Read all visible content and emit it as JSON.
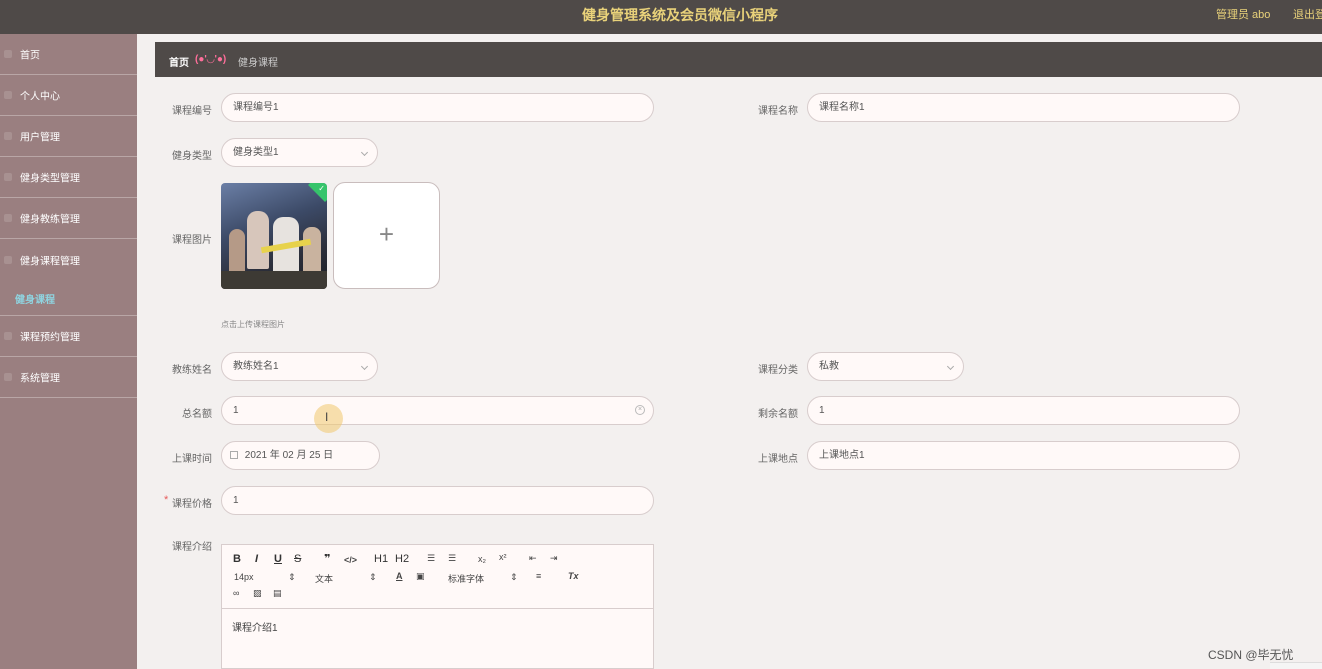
{
  "app": {
    "title": "健身管理系统及会员微信小程序",
    "user": "管理员 abo",
    "logout": "退出登"
  },
  "sidebar": {
    "items": [
      {
        "label": "首页",
        "icon": "home-icon"
      },
      {
        "label": "个人中心",
        "icon": "user-icon"
      },
      {
        "label": "用户管理",
        "icon": "users-icon"
      },
      {
        "label": "健身类型管理",
        "icon": "list-icon"
      },
      {
        "label": "健身教练管理",
        "icon": "coach-icon"
      },
      {
        "label": "健身课程管理",
        "icon": "course-icon"
      },
      {
        "label": "课程预约管理",
        "icon": "booking-icon"
      },
      {
        "label": "系统管理",
        "icon": "settings-icon"
      }
    ],
    "active_sub": "健身课程"
  },
  "breadcrumb": {
    "home": "首页",
    "face": "(●'◡'●)",
    "current": "健身课程"
  },
  "form": {
    "course_no": {
      "label": "课程编号",
      "value": "课程编号1"
    },
    "course_name": {
      "label": "课程名称",
      "value": "课程名称1"
    },
    "fitness_type": {
      "label": "健身类型",
      "value": "健身类型1"
    },
    "course_image": {
      "label": "课程图片",
      "hint": "点击上传课程图片",
      "upload_symbol": "+"
    },
    "coach_name": {
      "label": "教练姓名",
      "value": "教练姓名1"
    },
    "course_category": {
      "label": "课程分类",
      "value": "私教"
    },
    "total_quota": {
      "label": "总名额",
      "value": "1"
    },
    "remaining_quota": {
      "label": "剩余名额",
      "value": "1"
    },
    "class_time": {
      "label": "上课时间",
      "value": "2021 年 02 月 25 日"
    },
    "class_location": {
      "label": "上课地点",
      "value": "上课地点1"
    },
    "course_price": {
      "label": "课程价格",
      "value": "1",
      "required_mark": "*"
    },
    "course_intro": {
      "label": "课程介绍",
      "value": "课程介绍1"
    }
  },
  "editor_toolbar": {
    "bold": "B",
    "italic": "I",
    "underline": "U",
    "strike": "S",
    "quote": "❞",
    "code": "</>",
    "h1": "H1",
    "h2": "H2",
    "font_size": "14px",
    "text_style": "文本",
    "font_family": "标准字体"
  },
  "watermark": "CSDN @毕无忧"
}
